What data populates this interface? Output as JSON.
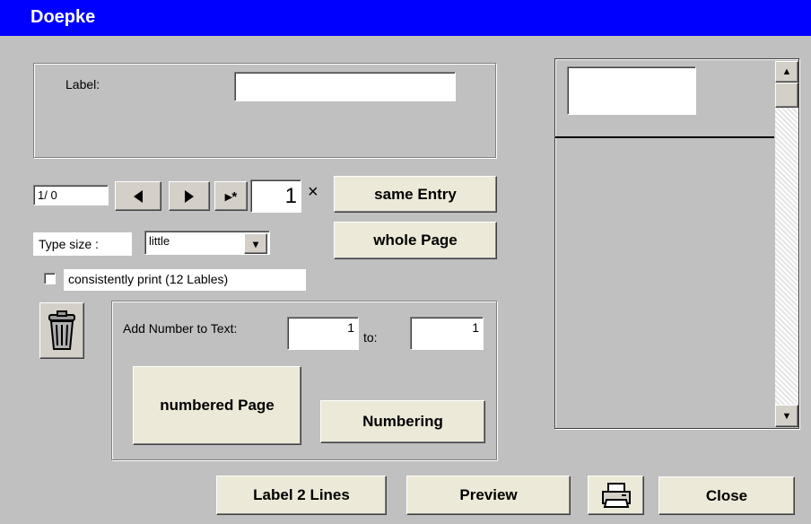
{
  "window": {
    "title": "Doepke"
  },
  "label_group": {
    "label_text": "Label:",
    "label_value": ""
  },
  "navigator": {
    "record_display": "1/ 0",
    "prev_icon": "triangle-left",
    "next_icon": "triangle-right",
    "new_icon": "triangle-right-asterisk",
    "new_symbol": "▸*",
    "copies_value": "1",
    "times_symbol": "×"
  },
  "buttons": {
    "same_entry": "same Entry",
    "whole_page": "whole Page",
    "numbered_page": "numbered Page",
    "numbering": "Numbering",
    "label_2_lines": "Label 2 Lines",
    "preview": "Preview",
    "close": "Close",
    "print_icon": "printer-icon",
    "delete_icon": "trash-can-icon"
  },
  "type_size": {
    "label": "Type size :",
    "value": "little",
    "dropdown_glyph": "▾"
  },
  "consistently_print": {
    "label": "consistently print (12 Lables)",
    "checked": false
  },
  "numbering_group": {
    "label": "Add Number to Text:",
    "from_value": "1",
    "to_label": "to:",
    "to_value": "1"
  },
  "scrollbar": {
    "up_glyph": "▲",
    "down_glyph": "▼"
  },
  "colors": {
    "titlebar": "#0000ff",
    "background": "#c0c0c0",
    "button_face": "#ece9d8"
  }
}
